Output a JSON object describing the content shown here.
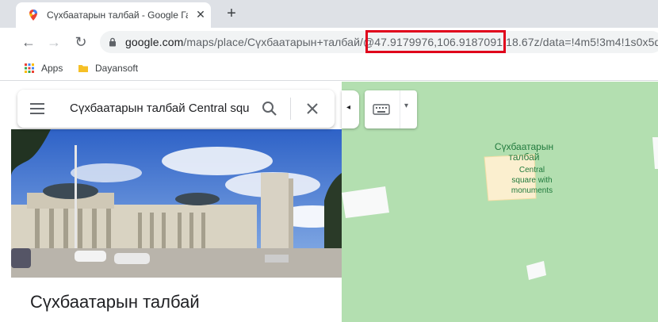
{
  "browser": {
    "tab": {
      "title": "Сүхбаатарын талбай - Google Газ",
      "close_glyph": "✕",
      "favicon": "maps-pin-icon"
    },
    "new_tab_glyph": "+",
    "nav": {
      "back": "←",
      "forward": "→",
      "reload": "↻"
    },
    "url": {
      "host": "google.com",
      "path": "/maps/place/Сүхбаатарын+талбай/@47.9179976,106.9187091,18.67z/data=!4m5!3m4!1s0x5d"
    },
    "bookmarks": [
      {
        "label": "Apps",
        "icon": "apps-grid-icon"
      },
      {
        "label": "Dayansoft",
        "icon": "folder-icon"
      }
    ]
  },
  "maps": {
    "search_query": "Сүхбаатарын талбай Central square",
    "place_title": "Сүхбаатарын талбай",
    "map_labels": {
      "name_line1": "Сүхбаатарын",
      "name_line2": "талбай",
      "desc_line1": "Central",
      "desc_line2": "square with",
      "desc_line3": "monuments"
    },
    "collapse_glyph": "◂",
    "dropdown_glyph": "▾"
  },
  "colors": {
    "highlight": "#e0001b",
    "map_green": "#b3dfb0",
    "label_green": "#217a3d"
  }
}
